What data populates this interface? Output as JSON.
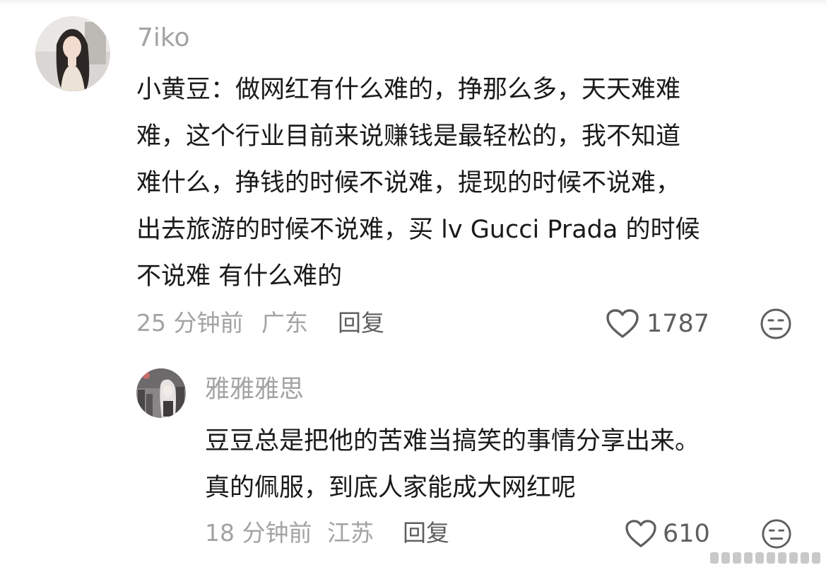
{
  "comments": [
    {
      "username": "7iko",
      "avatar_icon": "user-avatar-icon",
      "lines": [
        "小黄豆：做网红有什么难的，挣那么多，天天难难",
        "难，这个行业目前来说赚钱是最轻松的，我不知道",
        "难什么，挣钱的时候不说难，提现的时候不说难，",
        "出去旅游的时候不说难，买 lv Gucci Prada 的时候",
        "不说难 有什么难的"
      ],
      "time": "25 分钟前",
      "location": "广东",
      "reply_label": "回复",
      "likes": "1787"
    },
    {
      "username": "雅雅雅思",
      "avatar_icon": "user-avatar-icon",
      "lines": [
        "豆豆总是把他的苦难当搞笑的事情分享出来。",
        "真的佩服，到底人家能成大网红呢"
      ],
      "time": "18 分钟前",
      "location": "江苏",
      "reply_label": "回复",
      "likes": "610"
    }
  ],
  "colors": {
    "meta_text": "#a3a3a3",
    "body_text": "#1a1a1a",
    "action_text": "#5e5e5e"
  }
}
